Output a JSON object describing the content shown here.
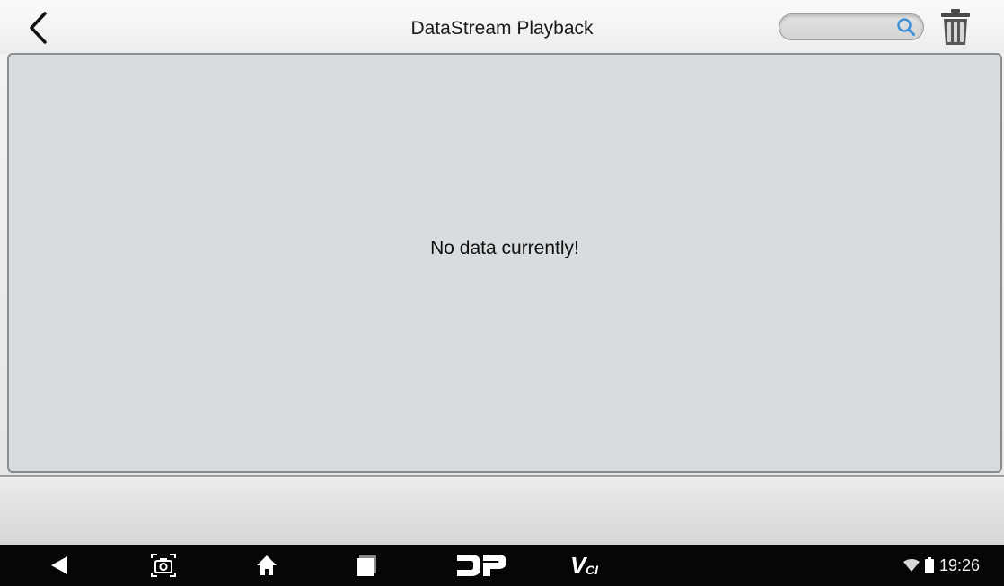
{
  "header": {
    "title": "DataStream Playback",
    "back_icon": "chevron-left-icon",
    "search": {
      "value": "",
      "placeholder": "",
      "icon": "search-icon"
    },
    "delete_icon": "trash-icon"
  },
  "main": {
    "empty_message": "No data currently!"
  },
  "nav_bar": {
    "items": [
      {
        "icon": "back-triangle-icon"
      },
      {
        "icon": "screenshot-camera-icon"
      },
      {
        "icon": "home-icon"
      },
      {
        "icon": "recent-apps-icon"
      },
      {
        "icon": "dp-logo-icon",
        "text": "DP"
      },
      {
        "icon": "vci-logo-icon",
        "text": "VCI"
      }
    ],
    "status": {
      "wifi_icon": "wifi-icon",
      "battery_icon": "battery-icon",
      "time": "19:26"
    }
  },
  "colors": {
    "accent": "#3b8fd9",
    "panel_background": "#d9dcde",
    "nav_background": "#060606"
  }
}
